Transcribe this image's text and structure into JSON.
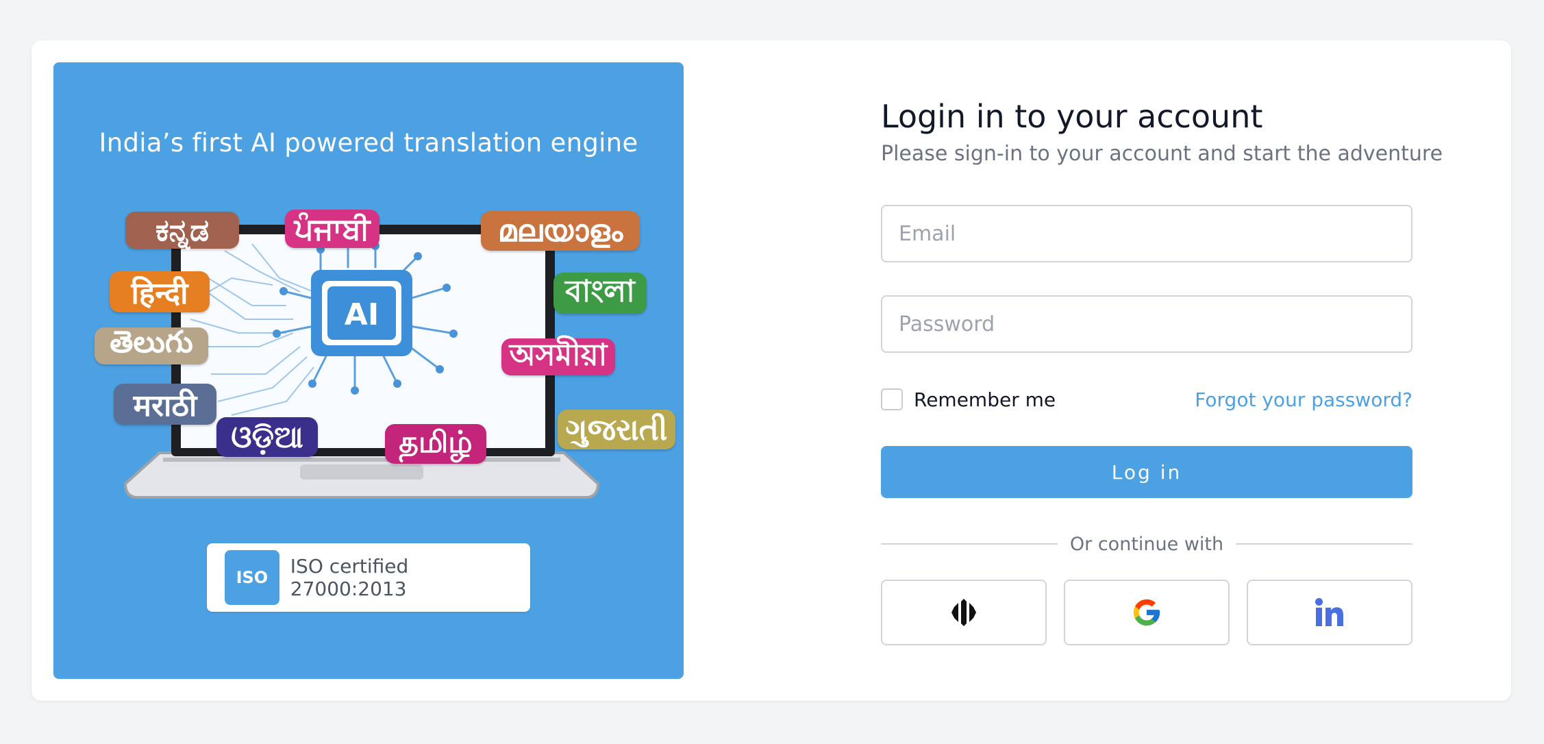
{
  "left_panel": {
    "tagline": "India’s first AI powered translation engine",
    "background_color": "#4ca1e3",
    "illustration": {
      "center_chip_label": "AI",
      "languages": [
        {
          "label": "ಕನ್ನಡ",
          "color": "#a0614e"
        },
        {
          "label": "ਪੰਜਾਬੀ",
          "color": "#d63384"
        },
        {
          "label": "മലയാളം",
          "color": "#c9733e"
        },
        {
          "label": "हिन्दी",
          "color": "#e67e22"
        },
        {
          "label": "বাংলা",
          "color": "#3d9b45"
        },
        {
          "label": "తెలుగు",
          "color": "#b7a58a"
        },
        {
          "label": "অসমীয়া",
          "color": "#d63384"
        },
        {
          "label": "मराठी",
          "color": "#5b6e93"
        },
        {
          "label": "ଓଡ଼ିଆ",
          "color": "#3a2f8a"
        },
        {
          "label": "தமிழ்",
          "color": "#c2257a"
        },
        {
          "label": "ગુજરાતી",
          "color": "#b8a850"
        }
      ]
    },
    "iso_badge": {
      "logo_text": "ISO",
      "text": "ISO certified 27000:2013"
    }
  },
  "form": {
    "title": "Login in to your account",
    "subtitle": "Please sign-in to your account and start the adventure",
    "email": {
      "placeholder": "Email",
      "value": ""
    },
    "password": {
      "placeholder": "Password",
      "value": ""
    },
    "remember_label": "Remember me",
    "remember_checked": false,
    "forgot_label": "Forgot your password?",
    "login_label": "Log in",
    "divider_text": "Or continue with",
    "social": [
      {
        "icon": "sso-shield-icon"
      },
      {
        "icon": "google-icon"
      },
      {
        "icon": "linkedin-icon"
      }
    ]
  },
  "colors": {
    "accent": "#4ca1e3",
    "page_bg": "#f3f4f6",
    "linkedin": "#4a6fe0"
  }
}
